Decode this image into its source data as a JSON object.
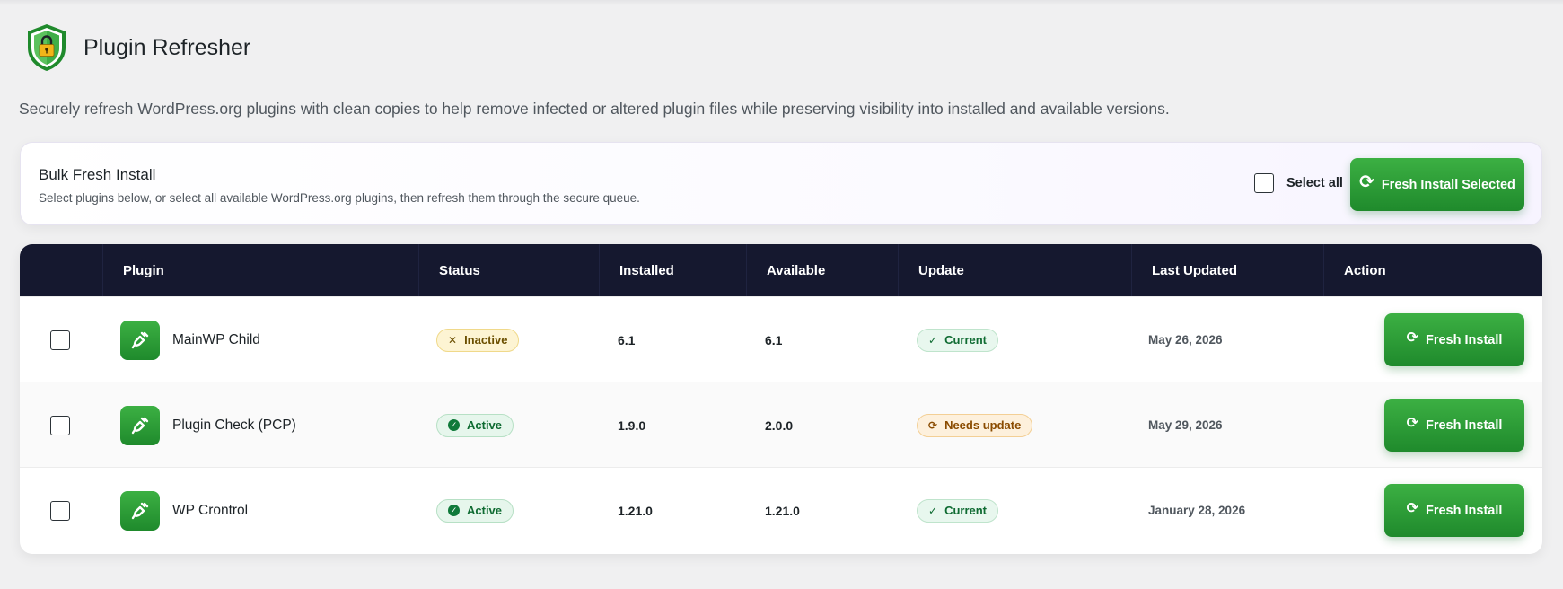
{
  "header": {
    "title": "Plugin Refresher",
    "description": "Securely refresh WordPress.org plugins with clean copies to help remove infected or altered plugin files while preserving visibility into installed and available versions."
  },
  "bulk": {
    "title": "Bulk Fresh Install",
    "subtitle": "Select plugins below, or select all available WordPress.org plugins, then refresh them through the secure queue.",
    "select_all_label": "Select all",
    "button_label": "Fresh Install Selected"
  },
  "table": {
    "columns": [
      "",
      "Plugin",
      "Status",
      "Installed",
      "Available",
      "Update",
      "Last Updated",
      "Action"
    ],
    "rows": [
      {
        "name": "MainWP Child",
        "status": "Inactive",
        "installed": "6.1",
        "available": "6.1",
        "update": "Current",
        "last_updated": "May 26, 2026",
        "action": "Fresh Install"
      },
      {
        "name": "Plugin Check (PCP)",
        "status": "Active",
        "installed": "1.9.0",
        "available": "2.0.0",
        "update": "Needs update",
        "last_updated": "May 29, 2026",
        "action": "Fresh Install"
      },
      {
        "name": "WP Crontrol",
        "status": "Active",
        "installed": "1.21.0",
        "available": "1.21.0",
        "update": "Current",
        "last_updated": "January 28, 2026",
        "action": "Fresh Install"
      }
    ]
  },
  "colors": {
    "header_bg": "#15182f",
    "accent_green": "#2a9d37",
    "page_bg": "#f0f0f1"
  },
  "icons": {
    "logo": "shield-lock-icon",
    "plugin": "plug-icon",
    "refresh": "refresh-icon"
  }
}
